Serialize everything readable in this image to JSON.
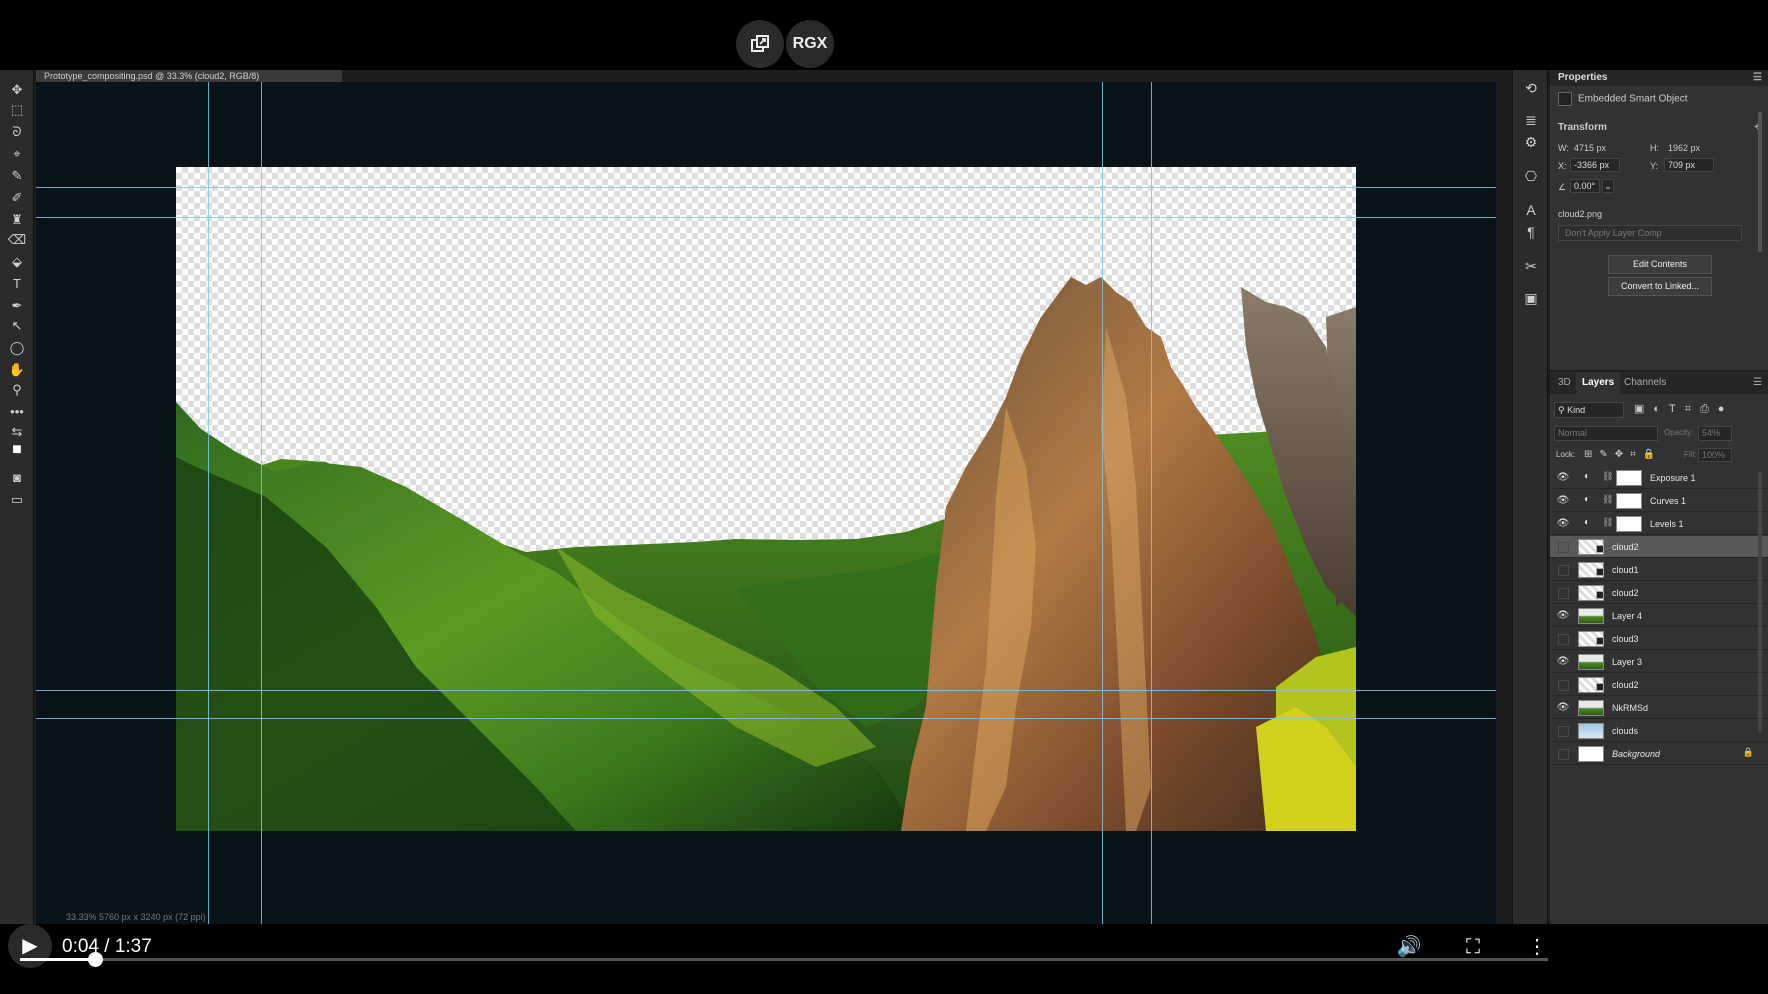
{
  "player": {
    "top_buttons": {
      "copy_icon": "copy-icon",
      "rgx_label": "RGX"
    },
    "time_display": "0:04 / 1:37",
    "progress": 0.0491,
    "icons": {
      "play": "play-icon",
      "volume": "volume-icon",
      "fullscreen": "fullscreen-icon",
      "more": "more-vertical-icon"
    }
  },
  "photoshop": {
    "document_tab": "Prototype_compositing.psd @ 33.3% (cloud2, RGB/8)",
    "status_bar": "33.33%   5760 px x 3240 px (72 ppi)",
    "tools": [
      "move-tool-icon",
      "marquee-tool-icon",
      "lasso-tool-icon",
      "quick-select-icon",
      "eyedropper-icon",
      "brush-icon",
      "stamp-icon",
      "eraser-icon",
      "paint-bucket-icon",
      "type-tool-icon",
      "pen-tool-icon",
      "path-select-icon",
      "ellipse-tool-icon",
      "hand-tool-icon",
      "zoom-tool-icon",
      "more-tools-icon",
      "swap-colors-icon",
      "color-swatches-icon",
      "quick-mask-icon",
      "screen-mode-icon"
    ],
    "tool_glyphs": [
      "✥",
      "⬚",
      "ᘐ",
      "⌖",
      "✎",
      "✐",
      "♜",
      "⌫",
      "⬙",
      "T",
      "✒",
      "↖",
      "◯",
      "✋",
      "⚲",
      "•••",
      "⇆",
      "■",
      "◙",
      "▭"
    ],
    "strip_icons": [
      "history-icon",
      "brush-settings-icon",
      "adjust-icon",
      "clone-source-icon",
      "character-icon",
      "paragraph-icon",
      "tools-preset-icon",
      "libraries-icon"
    ],
    "strip_glyphs": [
      "⟲",
      "≣",
      "⚙",
      "⎔",
      "A",
      "¶",
      "✂",
      "▣"
    ],
    "properties": {
      "title": "Properties",
      "object_type": "Embedded Smart Object",
      "transform_label": "Transform",
      "w_label": "W:",
      "w_value": "4715 px",
      "h_label": "H:",
      "h_value": "1962 px",
      "x_label": "X:",
      "x_value": "-3366 px",
      "y_label": "Y:",
      "y_value": "709 px",
      "angle_value": "0.00°",
      "file_name": "cloud2.png",
      "layer_comp": "Don't Apply Layer Comp",
      "edit_button": "Edit Contents",
      "convert_button": "Convert to Linked..."
    },
    "layers_panel": {
      "tabs": [
        "3D",
        "Layers",
        "Channels"
      ],
      "active_tab": "Layers",
      "kind_filter": "Kind",
      "blend_mode": "Normal",
      "opacity_label": "Opacity:",
      "opacity_value": "54%",
      "lock_label": "Lock:",
      "fill_label": "Fill:",
      "fill_value": "100%",
      "layers": [
        {
          "name": "Exposure 1",
          "visible": true,
          "type": "adjustment"
        },
        {
          "name": "Curves 1",
          "visible": true,
          "type": "adjustment"
        },
        {
          "name": "Levels 1",
          "visible": true,
          "type": "adjustment"
        },
        {
          "name": "cloud2",
          "visible": false,
          "type": "smart",
          "selected": true
        },
        {
          "name": "cloud1",
          "visible": false,
          "type": "smart"
        },
        {
          "name": "cloud2",
          "visible": false,
          "type": "smart"
        },
        {
          "name": "Layer 4",
          "visible": true,
          "type": "pixel"
        },
        {
          "name": "cloud3",
          "visible": false,
          "type": "smart"
        },
        {
          "name": "Layer 3",
          "visible": true,
          "type": "pixel"
        },
        {
          "name": "cloud2",
          "visible": false,
          "type": "smart"
        },
        {
          "name": "NkRMSd",
          "visible": true,
          "type": "pixel"
        },
        {
          "name": "clouds",
          "visible": false,
          "type": "pixel"
        },
        {
          "name": "Background",
          "visible": false,
          "type": "background",
          "locked": true
        }
      ]
    },
    "colors": {
      "guide": "#7cc9e4",
      "panel": "#323232",
      "accent": "#c9792c"
    }
  }
}
